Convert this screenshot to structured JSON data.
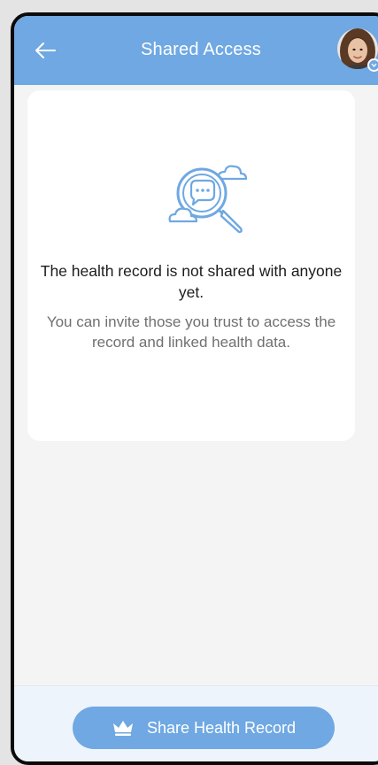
{
  "header": {
    "title": "Shared Access",
    "back_icon": "arrow-left-icon",
    "avatar_icon": "user-avatar-icon"
  },
  "empty_state": {
    "icon": "search-chat-icon",
    "title": "The health record is not shared with anyone yet.",
    "description": "You can invite those you trust to access the record and linked health data."
  },
  "footer": {
    "share_button_label": "Share Health Record",
    "share_button_icon": "crown-icon"
  },
  "colors": {
    "accent": "#6fa8e2",
    "background": "#f4f4f4",
    "card": "#ffffff",
    "title_text": "#1c1c1c",
    "secondary_text": "#707070"
  }
}
